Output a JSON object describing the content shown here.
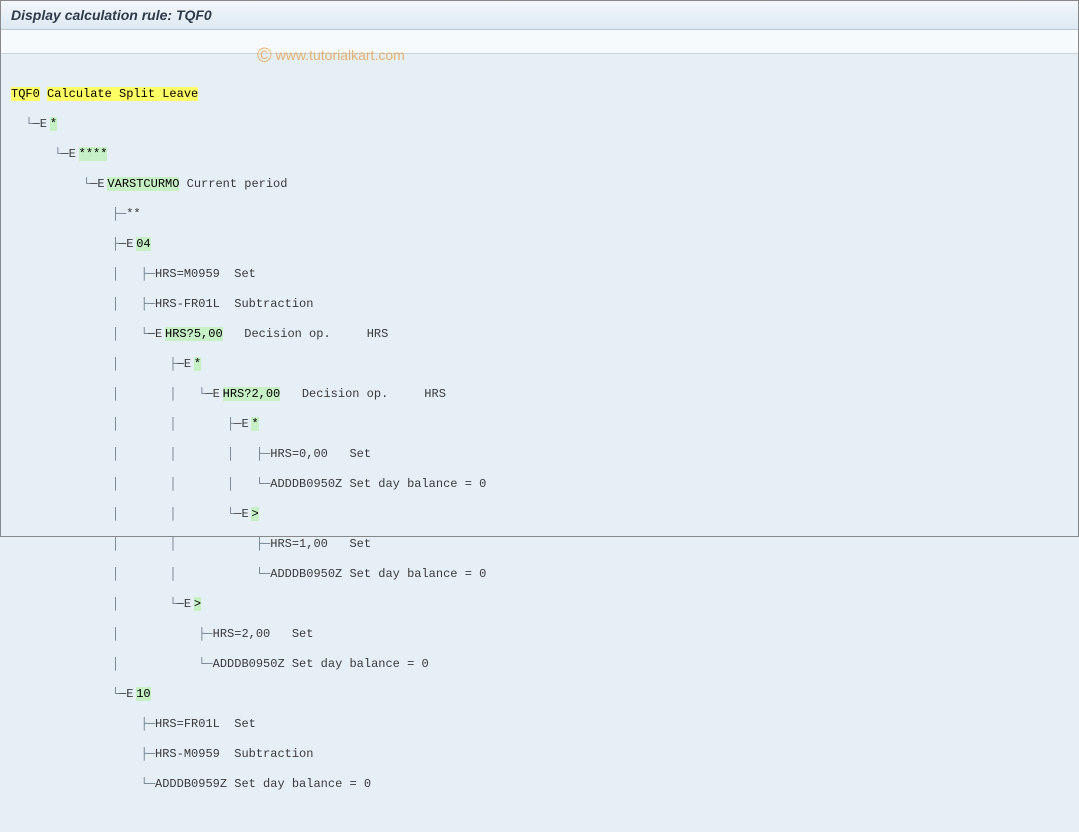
{
  "title": "Display calculation rule: TQF0",
  "watermark": "www.tutorialkart.com",
  "rule": {
    "code": "TQF0",
    "desc": "Calculate Split Leave"
  },
  "n1": "*",
  "n2": "****",
  "varst": {
    "op": "VARSTCURMO",
    "desc": "Current period"
  },
  "star2": "**",
  "g04": "04",
  "g04a": {
    "op": "HRS=M0959",
    "desc": "Set"
  },
  "g04b": {
    "op": "HRS-FR01L",
    "desc": "Subtraction"
  },
  "dec5": {
    "op": "HRS?5,00",
    "desc": "Decision op.",
    "extra": "HRS"
  },
  "starA": "*",
  "dec2": {
    "op": "HRS?2,00",
    "desc": "Decision op.",
    "extra": "HRS"
  },
  "starB": "*",
  "set0": {
    "op": "HRS=0,00",
    "desc": "Set"
  },
  "addA": {
    "op": "ADDDB0950Z",
    "desc": "Set day balance = 0"
  },
  "gt1": ">",
  "set1": {
    "op": "HRS=1,00",
    "desc": "Set"
  },
  "addB": {
    "op": "ADDDB0950Z",
    "desc": "Set day balance = 0"
  },
  "gt2": ">",
  "set2": {
    "op": "HRS=2,00",
    "desc": "Set"
  },
  "addC": {
    "op": "ADDDB0950Z",
    "desc": "Set day balance = 0"
  },
  "g10": "10",
  "g10a": {
    "op": "HRS=FR01L",
    "desc": "Set"
  },
  "g10b": {
    "op": "HRS-M0959",
    "desc": "Subtraction"
  },
  "g10c": {
    "op": "ADDDB0959Z",
    "desc": "Set day balance = 0"
  },
  "expander": "─E"
}
